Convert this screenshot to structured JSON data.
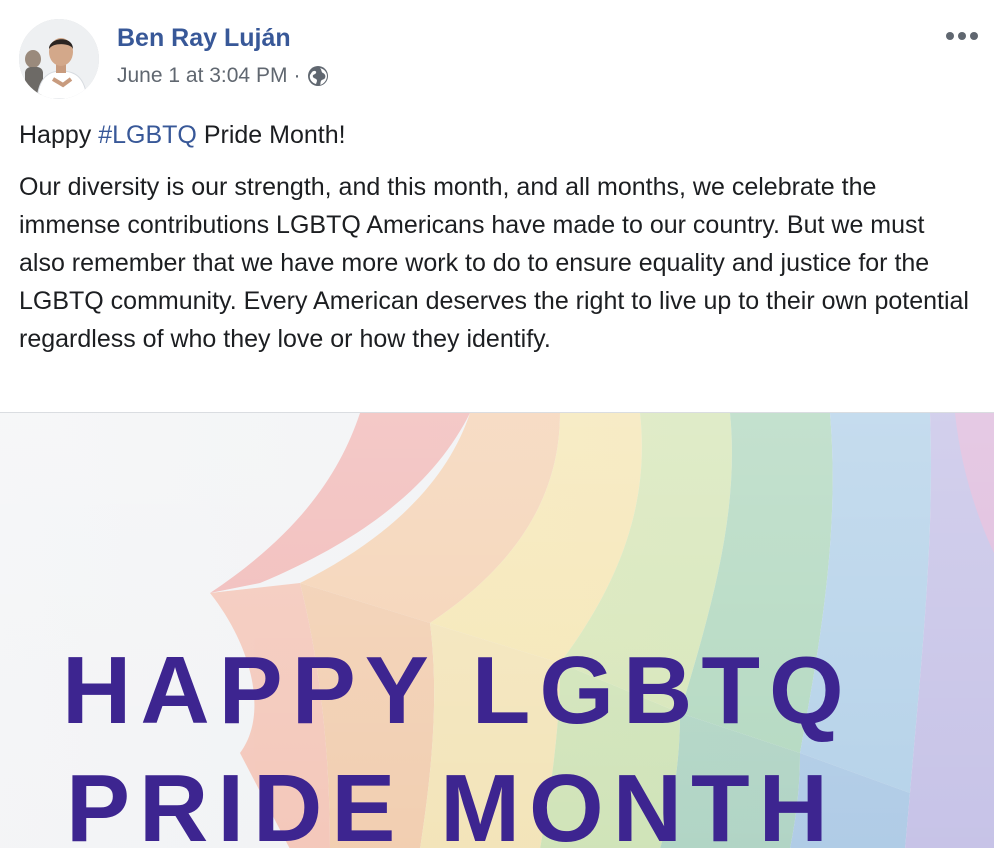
{
  "post": {
    "author": "Ben Ray Luján",
    "timestamp": "June 1 at 3:04 PM",
    "separator": "·",
    "audience_icon": "globe-icon",
    "more_icon": "more-options-icon",
    "text": {
      "line1_prefix": "Happy ",
      "hashtag": "#LGBTQ",
      "line1_suffix": " Pride Month!",
      "paragraph": "Our diversity is our strength, and this month, and all months, we celebrate the immense contributions LGBTQ Americans have made to our country. But we must also remember that we have more work to do to ensure equality and justice for the LGBTQ community. Every American deserves the right to live up to their own potential regardless of who they love or how they identify."
    },
    "image": {
      "headline_line1": "HAPPY LGBTQ",
      "headline_line2": "PRIDE MONTH",
      "headline_color": "#3d2590"
    }
  },
  "colors": {
    "link": "#385898",
    "meta": "#606770",
    "text": "#1c1e21"
  }
}
